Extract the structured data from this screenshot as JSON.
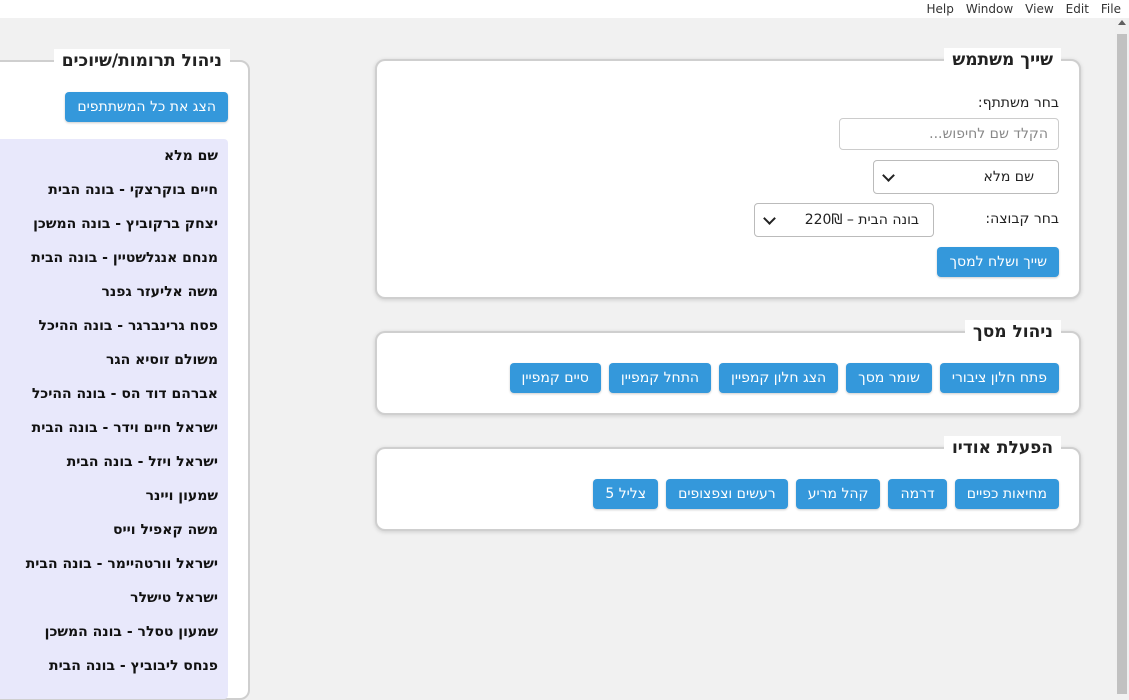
{
  "menu": [
    "File",
    "Edit",
    "View",
    "Window",
    "Help"
  ],
  "donations": {
    "title": "ניהול תרומות/שיוכים",
    "show_all_button": "הצג את כל המשתתפים",
    "names": [
      "שם מלא",
      "חיים בוקרצקי - בונה הבית",
      "יצחק ברקוביץ - בונה המשכן",
      "מנחם אנגלשטיין - בונה הבית",
      "משה אליעזר גפנר",
      "פסח גרינברגר - בונה ההיכל",
      "משולם זוסיא הגר",
      "אברהם דוד הס - בונה ההיכל",
      "ישראל חיים וידר - בונה הבית",
      "ישראל ויזל - בונה הבית",
      "שמעון ויינר",
      "משה קאפיל וייס",
      "ישראל וורטהיימר - בונה הבית",
      "ישראל טישלר",
      "שמעון טסלר - בונה המשכן",
      "פנחס ליבוביץ - בונה הבית"
    ]
  },
  "assign": {
    "title": "שייך משתמש",
    "choose_participant_label": "בחר משתתף:",
    "search_placeholder": "הקלד שם לחיפוש...",
    "participant_select_value": "שם מלא",
    "choose_group_label": "בחר קבוצה:",
    "group_select_value": "בונה הבית – 220₪",
    "submit_button": "שייך ושלח למסך"
  },
  "screen": {
    "title": "ניהול מסך",
    "buttons": [
      "פתח חלון ציבורי",
      "שומר מסך",
      "הצג חלון קמפיין",
      "התחל קמפיין",
      "סיים קמפיין"
    ]
  },
  "audio": {
    "title": "הפעלת אודיו",
    "buttons": [
      "מחיאות כפיים",
      "דרמה",
      "קהל מריע",
      "רעשים וצפצופים",
      "צליל 5"
    ]
  },
  "colors": {
    "accent": "#3498db",
    "list_bg": "#e8e8fb"
  }
}
